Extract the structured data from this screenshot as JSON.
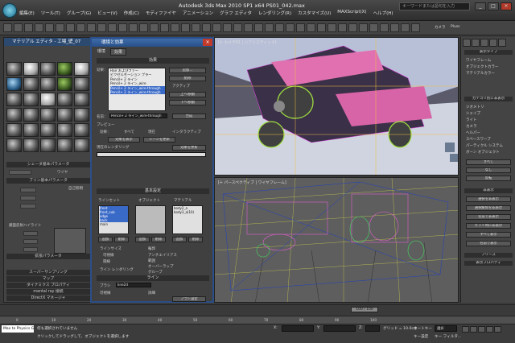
{
  "window": {
    "title": "Autodesk 3ds Max  2010 SP1 x64    PS01_042.max",
    "search_placeholder": "キーワードまたは語句を入力",
    "menu": [
      "編集(E)",
      "ツール(T)",
      "グループ(G)",
      "ビュー(V)",
      "作成(C)",
      "モディファイヤ",
      "アニメーション",
      "グラフ エディタ",
      "レンダリング(R)",
      "カスタマイズ(U)",
      "MAXScript(X)",
      "ヘルプ(H)"
    ],
    "toolbar_extra": [
      "カメラ",
      "Pluss"
    ]
  },
  "material_editor": {
    "title": "マテリアル エディタ - 工場_壁_07",
    "rollouts": [
      "シェーダ基本パラメータ",
      "ブリン基本パラメータ",
      "拡張パラメータ",
      "スーパーサンプリング",
      "マップ",
      "ダイナミクス プロパティ",
      "mental ray 接続",
      "DirectX マネージャ"
    ],
    "labels": {
      "wire": "ワイヤ",
      "color_label": "自己照明",
      "shader": "ブリン",
      "spec": "鏡面反射ハイライト"
    }
  },
  "env_dialog": {
    "title": "環境と効果",
    "tabs": [
      "環境",
      "効果"
    ],
    "effects_rollout": "効果",
    "effects_label": "効果：",
    "effects": [
      "Hair およびファー",
      "ピクセルモーション ブラー",
      "Pencil+ 2 ライン",
      "Pencil+ 2 ライン_wire",
      "Pencil+ 2 ライン_wire-through",
      "Pencil+ 2 ライン_wire-through"
    ],
    "side_buttons": [
      "追加...",
      "削除",
      "アクティブ",
      "上へ移動",
      "下へ移動",
      "合成"
    ],
    "active_checkbox": "アクティブ",
    "name_label": "名前：",
    "name_value": "Pencil+ 2 ライン_wire-through",
    "preview": "プレビュー",
    "preview_options": [
      "効果：",
      "すべて",
      "現在",
      "インタラクティブ"
    ],
    "preview_buttons": [
      "効果を表示",
      "シーンを更新"
    ],
    "update_button": "効果を更新",
    "status_label": "現在のレンダリング",
    "basic_rollout": "基本設定",
    "line_set_label": "ラインセット",
    "objects_label": "オブジェクト",
    "material_label": "マテリアル",
    "line_sets": [
      "front",
      "front_sub",
      "edge",
      "back",
      "main"
    ],
    "line_sets_right": [
      "body2_a",
      "body3_a(10)"
    ],
    "set_buttons": [
      "追加",
      "削除",
      "追加",
      "削除",
      "追加",
      "削除"
    ],
    "line_size": "ラインサイズ",
    "outline_label": "輪郭",
    "visible": "可視線",
    "hidden_label": "隠線",
    "line_options": [
      "アンチエイリアス",
      "範囲",
      "オーバーラップ",
      "グループ"
    ],
    "line_rollout": "ライン",
    "brush_label": "ブラシ",
    "line_value": "line2d",
    "detail_label": "詳細",
    "line_render": "ライン レンダリング",
    "visible_line": "可視線",
    "brush_settings": "ブラシ設定"
  },
  "viewports": {
    "top_label": "[+ カメラ01 | リアリスティック]",
    "bottom_label": "[+ パースペクティブ | ワイヤフレーム]"
  },
  "command_panel": {
    "display_rollout": "表示タイプ",
    "display_types": [
      "ワイヤフレーム",
      "オブジェクトカラー",
      "マテリアルカラー"
    ],
    "hide_by_category": "カテゴリ別に非表示",
    "categories": [
      "ジオメトリ",
      "シェイプ",
      "ライト",
      "カメラ",
      "ヘルパー",
      "スペースワープ",
      "パーティクル システム",
      "ボーン オブジェクト"
    ],
    "buttons": [
      "すべて",
      "なし",
      "反転"
    ],
    "hide_rollout": "非表示",
    "hide_buttons": [
      "選択を非表示",
      "選択解除を非表示",
      "名前で非表示",
      "ヒット時に非表示",
      "すべて表示",
      "名前で表示"
    ],
    "freeze_rollout": "フリーズ",
    "display_props": "表示プロパティ"
  },
  "timeline": {
    "frame": "100 / 100",
    "ticks": [
      "0",
      "10",
      "20",
      "30",
      "40",
      "50",
      "60",
      "70",
      "80",
      "90",
      "100"
    ]
  },
  "status": {
    "maxscript": "Max to Physics Gr",
    "line1": "何も選択されていません",
    "line2": "クリックしてドラッグして、オブジェクトを選択します",
    "grid": "グリッド = 10.0cm",
    "autokey": "オートキー",
    "setkey": "キー設定",
    "selected": "選択",
    "key_filter": "キー フィルタ...",
    "x": "X:",
    "y": "Y:",
    "z": "Z:"
  }
}
